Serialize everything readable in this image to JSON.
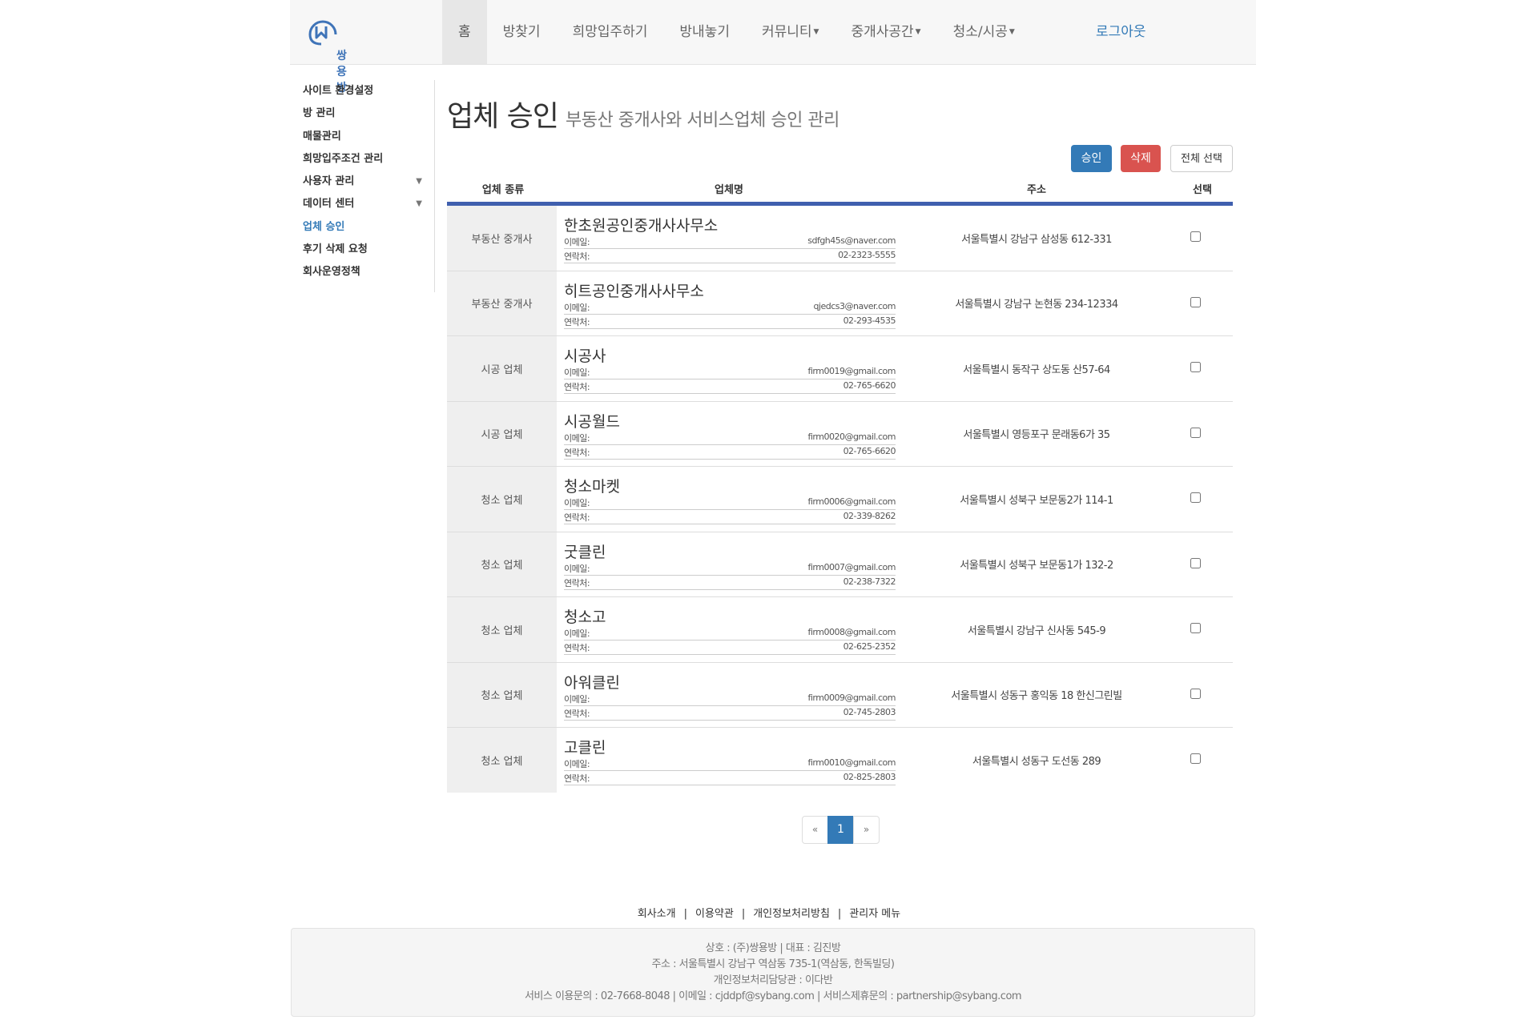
{
  "brand": {
    "name": "쌍용방"
  },
  "nav": {
    "items": [
      {
        "label": "홈",
        "dropdown": false,
        "active": true
      },
      {
        "label": "방찾기",
        "dropdown": false
      },
      {
        "label": "희망입주하기",
        "dropdown": false
      },
      {
        "label": "방내놓기",
        "dropdown": false
      },
      {
        "label": "커뮤니티",
        "dropdown": true
      },
      {
        "label": "중개사공간",
        "dropdown": true
      },
      {
        "label": "청소/시공",
        "dropdown": true
      }
    ],
    "logout": "로그아웃"
  },
  "sidebar": {
    "items": [
      {
        "label": "사이트 환경설정"
      },
      {
        "label": "방 관리"
      },
      {
        "label": "매물관리"
      },
      {
        "label": "희망입주조건 관리"
      },
      {
        "label": "사용자 관리",
        "expandable": true
      },
      {
        "label": "데이터 센터",
        "expandable": true
      },
      {
        "label": "업체 승인",
        "active": true
      },
      {
        "label": "후기 삭제 요청"
      },
      {
        "label": "회사운영정책"
      }
    ]
  },
  "header": {
    "title": "업체 승인",
    "subtitle": "부동산 중개사와 서비스업체 승인 관리"
  },
  "toolbar": {
    "approve_label": "승인",
    "delete_label": "삭제",
    "select_all_label": "전체 선택"
  },
  "table": {
    "columns": {
      "type": "업체 종류",
      "name": "업체명",
      "address": "주소",
      "select": "선택"
    },
    "email_label": "이메일:",
    "phone_label": "연락처:",
    "rows": [
      {
        "type": "부동산 중개사",
        "name": "한초원공인중개사사무소",
        "email": "sdfgh45s@naver.com",
        "phone": "02-2323-5555",
        "address": "서울특별시 강남구 삼성동 612-331",
        "checked": false
      },
      {
        "type": "부동산 중개사",
        "name": "히트공인중개사사무소",
        "email": "qjedcs3@naver.com",
        "phone": "02-293-4535",
        "address": "서울특별시 강남구 논현동 234-12334",
        "checked": false
      },
      {
        "type": "시공 업체",
        "name": "시공사",
        "email": "firm0019@gmail.com",
        "phone": "02-765-6620",
        "address": "서울특별시 동작구 상도동 산57-64",
        "checked": false
      },
      {
        "type": "시공 업체",
        "name": "시공월드",
        "email": "firm0020@gmail.com",
        "phone": "02-765-6620",
        "address": "서울특별시 영등포구 문래동6가 35",
        "checked": false
      },
      {
        "type": "청소 업체",
        "name": "청소마켓",
        "email": "firm0006@gmail.com",
        "phone": "02-339-8262",
        "address": "서울특별시 성북구 보문동2가 114-1",
        "checked": false
      },
      {
        "type": "청소 업체",
        "name": "굿클린",
        "email": "firm0007@gmail.com",
        "phone": "02-238-7322",
        "address": "서울특별시 성북구 보문동1가 132-2",
        "checked": false
      },
      {
        "type": "청소 업체",
        "name": "청소고",
        "email": "firm0008@gmail.com",
        "phone": "02-625-2352",
        "address": "서울특별시 강남구 신사동 545-9",
        "checked": false
      },
      {
        "type": "청소 업체",
        "name": "아워클린",
        "email": "firm0009@gmail.com",
        "phone": "02-745-2803",
        "address": "서울특별시 성동구 홍익동 18 한신그린빌",
        "checked": false
      },
      {
        "type": "청소 업체",
        "name": "고클린",
        "email": "firm0010@gmail.com",
        "phone": "02-825-2803",
        "address": "서울특별시 성동구 도선동 289",
        "checked": false
      }
    ]
  },
  "pagination": {
    "prev": "«",
    "current": "1",
    "next": "»"
  },
  "footer": {
    "links": [
      "회사소개",
      "이용약관",
      "개인정보처리방침",
      "관리자 메뉴"
    ],
    "separator": "|",
    "lines": [
      "상호 : (주)쌍용방 | 대표 : 김진방",
      "주소 : 서울특별시 강남구 역삼동 735-1(역삼동, 한독빌딩)",
      "개인정보처리담당관 : 이다반",
      "서비스 이용문의 : 02-7668-8048 | 이메일 : cjddpf@sybang.com | 서비스제휴문의 : partnership@sybang.com"
    ]
  },
  "colors": {
    "primary": "#337ab7",
    "danger": "#d9534f",
    "table_rule": "#3f5fae",
    "logo": "#3f74b8"
  }
}
